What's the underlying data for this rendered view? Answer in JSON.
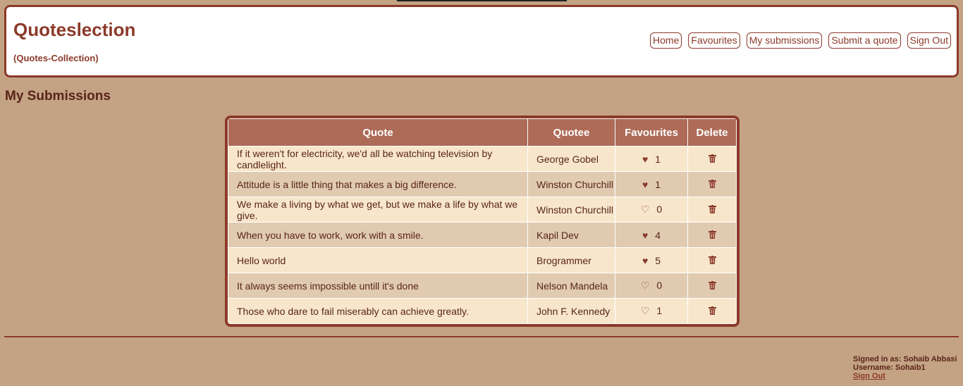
{
  "header": {
    "brand": "Quoteslection",
    "tagline": "(Quotes-Collection)",
    "nav": [
      "Home",
      "Favourites",
      "My submissions",
      "Submit a quote",
      "Sign Out"
    ]
  },
  "page": {
    "title": "My Submissions"
  },
  "table": {
    "columns": [
      "Quote",
      "Quotee",
      "Favourites",
      "Delete"
    ],
    "rows": [
      {
        "quote": "If it weren't for electricity, we'd all be watching television by candlelight.",
        "quotee": "George Gobel",
        "favourites": "1",
        "favourited": true
      },
      {
        "quote": "Attitude is a little thing that makes a big difference.",
        "quotee": "Winston Churchill",
        "favourites": "1",
        "favourited": true
      },
      {
        "quote": "We make a living by what we get, but we make a life by what we give.",
        "quotee": "Winston Churchill",
        "favourites": "0",
        "favourited": false
      },
      {
        "quote": "When you have to work, work with a smile.",
        "quotee": "Kapil Dev",
        "favourites": "4",
        "favourited": true
      },
      {
        "quote": "Hello world",
        "quotee": "Brogrammer",
        "favourites": "5",
        "favourited": true
      },
      {
        "quote": "It always seems impossible untill it's done",
        "quotee": "Nelson Mandela",
        "favourites": "0",
        "favourited": false
      },
      {
        "quote": "Those who dare to fail miserably can achieve greatly.",
        "quotee": "John F. Kennedy",
        "favourites": "1",
        "favourited": false
      }
    ],
    "icons": {
      "favourite": "heart-icon",
      "delete": "trash-icon"
    }
  },
  "footer": {
    "signed_in_as": "Signed in as: Sohaib Abbasi",
    "username": "Username: Sohaib1",
    "sign_out": "Sign Out"
  },
  "colors": {
    "background": "#c4a384",
    "accent": "#8b3a2a",
    "table_header": "#ad6b58",
    "row_odd": "#f7e6cb",
    "row_even": "#e0cbb1"
  }
}
